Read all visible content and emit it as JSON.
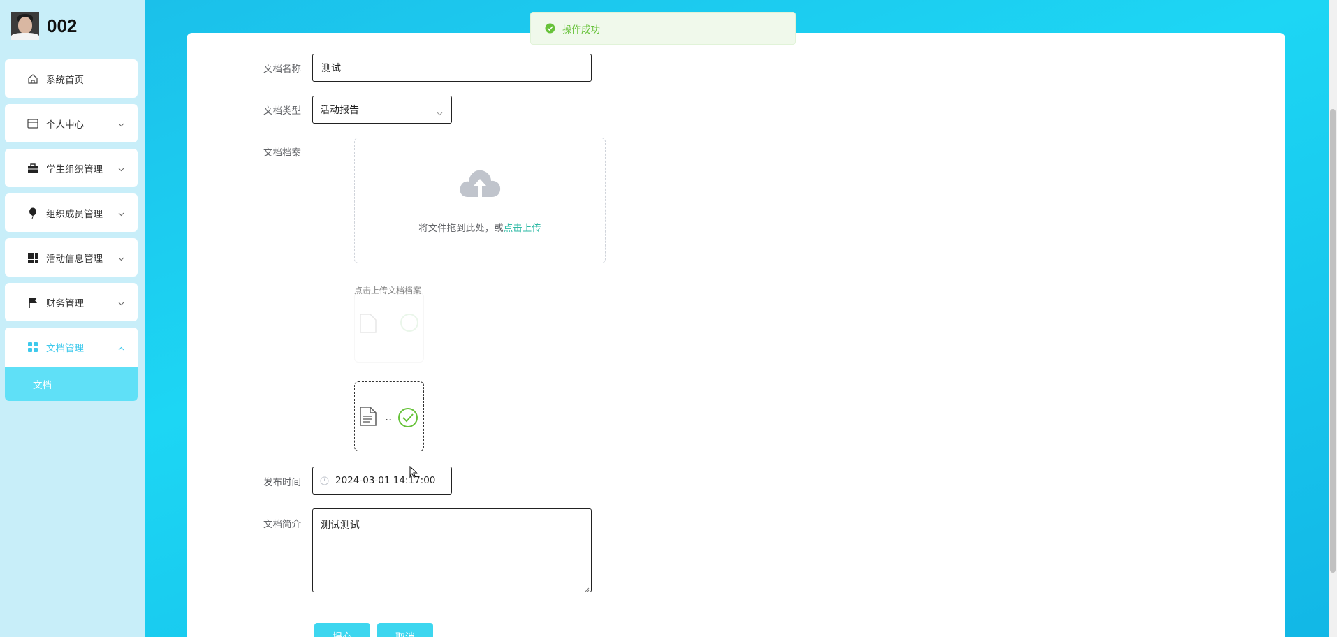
{
  "user": {
    "name": "002"
  },
  "sidebar": {
    "items": [
      {
        "label": "系统首页",
        "icon": "home-icon"
      },
      {
        "label": "个人中心",
        "icon": "credit-card-icon"
      },
      {
        "label": "学生组织管理",
        "icon": "briefcase-icon"
      },
      {
        "label": "组织成员管理",
        "icon": "balloon-icon"
      },
      {
        "label": "活动信息管理",
        "icon": "grid-icon"
      },
      {
        "label": "财务管理",
        "icon": "flag-icon"
      },
      {
        "label": "文档管理",
        "icon": "apps-icon"
      }
    ],
    "active_sub": "文档"
  },
  "toast": {
    "text": "操作成功"
  },
  "form": {
    "name_label": "文档名称",
    "name_value": "测试",
    "type_label": "文档类型",
    "type_value": "活动报告",
    "file_label": "文档档案",
    "upload_text": "将文件拖到此处，或",
    "upload_link": "点击上传",
    "upload_tip": "点击上传文档档案",
    "file_dots": "..",
    "time_label": "发布时间",
    "time_value": "2024-03-01 14:17:00",
    "intro_label": "文档简介",
    "intro_value": "测试测试",
    "submit_label": "提交",
    "cancel_label": "取消"
  },
  "colors": {
    "accent": "#3ec9ec",
    "success": "#67c23a",
    "link": "#2ebaa5"
  }
}
